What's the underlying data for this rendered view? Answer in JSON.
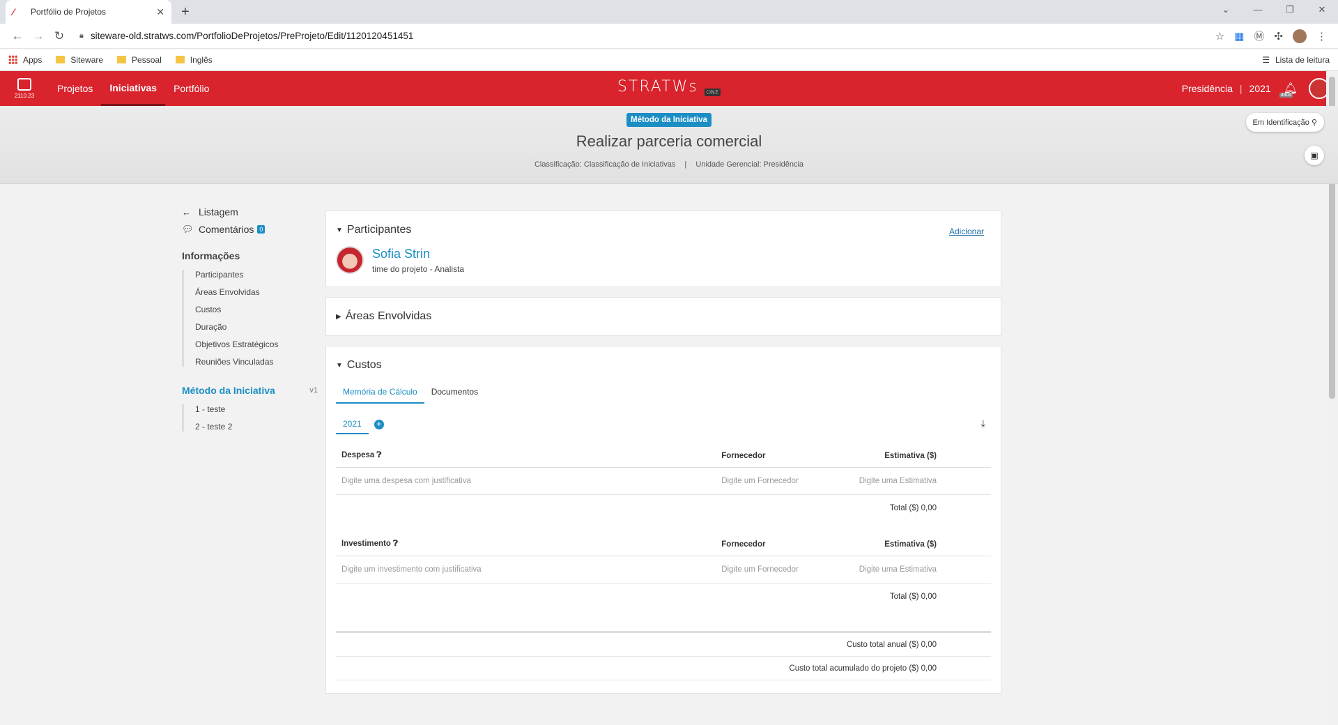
{
  "browser": {
    "tab_title": "Portfólio de Projetos",
    "url": "siteware-old.stratws.com/PortfolioDeProjetos/PreProjeto/Edit/1120120451451",
    "bookmarks": [
      "Apps",
      "Siteware",
      "Pessoal",
      "Inglês"
    ],
    "reading_list": "Lista de leitura"
  },
  "header": {
    "version": "2110.23",
    "menu": [
      "Projetos",
      "Iniciativas",
      "Portfólio"
    ],
    "brand": "STRATWs",
    "brand_sub": "ONE",
    "unit": "Presidência",
    "year": "2021",
    "notif_count": "4804"
  },
  "banner": {
    "badge": "Método da Iniciativa",
    "title": "Realizar parceria comercial",
    "classificacao": "Classificação: Classificação de Iniciativas",
    "unidade": "Unidade Gerencial: Presidência",
    "status": "Em Identificação"
  },
  "sidebar": {
    "listagem": "Listagem",
    "comentarios": "Comentários",
    "comentarios_count": "0",
    "info_title": "Informações",
    "info_items": [
      "Participantes",
      "Áreas Envolvidas",
      "Custos",
      "Duração",
      "Objetivos Estratégicos",
      "Reuniões Vinculadas"
    ],
    "metodo_title": "Método da Iniciativa",
    "metodo_version": "v1",
    "metodo_items": [
      "1 - teste",
      "2 - teste 2"
    ]
  },
  "participantes": {
    "title": "Participantes",
    "add": "Adicionar",
    "name": "Sofia Strin",
    "role": "time do projeto - Analista"
  },
  "areas": {
    "title": "Áreas Envolvidas"
  },
  "custos": {
    "title": "Custos",
    "tabs": [
      "Memória de Cálculo",
      "Documentos"
    ],
    "year": "2021",
    "despesa": {
      "col1": "Despesa",
      "col2": "Fornecedor",
      "col3": "Estimativa ($)",
      "ph1": "Digite uma despesa com justificativa",
      "ph2": "Digite um Fornecedor",
      "ph3": "Digite uma Estimativa",
      "total": "Total ($) 0,00"
    },
    "investimento": {
      "col1": "Investimento",
      "col2": "Fornecedor",
      "col3": "Estimativa ($)",
      "ph1": "Digite um investimento com justificativa",
      "ph2": "Digite um Fornecedor",
      "ph3": "Digite uma Estimativa",
      "total": "Total ($) 0,00"
    },
    "total_anual": "Custo total anual ($) 0,00",
    "total_acumulado": "Custo total acumulado do projeto ($) 0,00"
  }
}
